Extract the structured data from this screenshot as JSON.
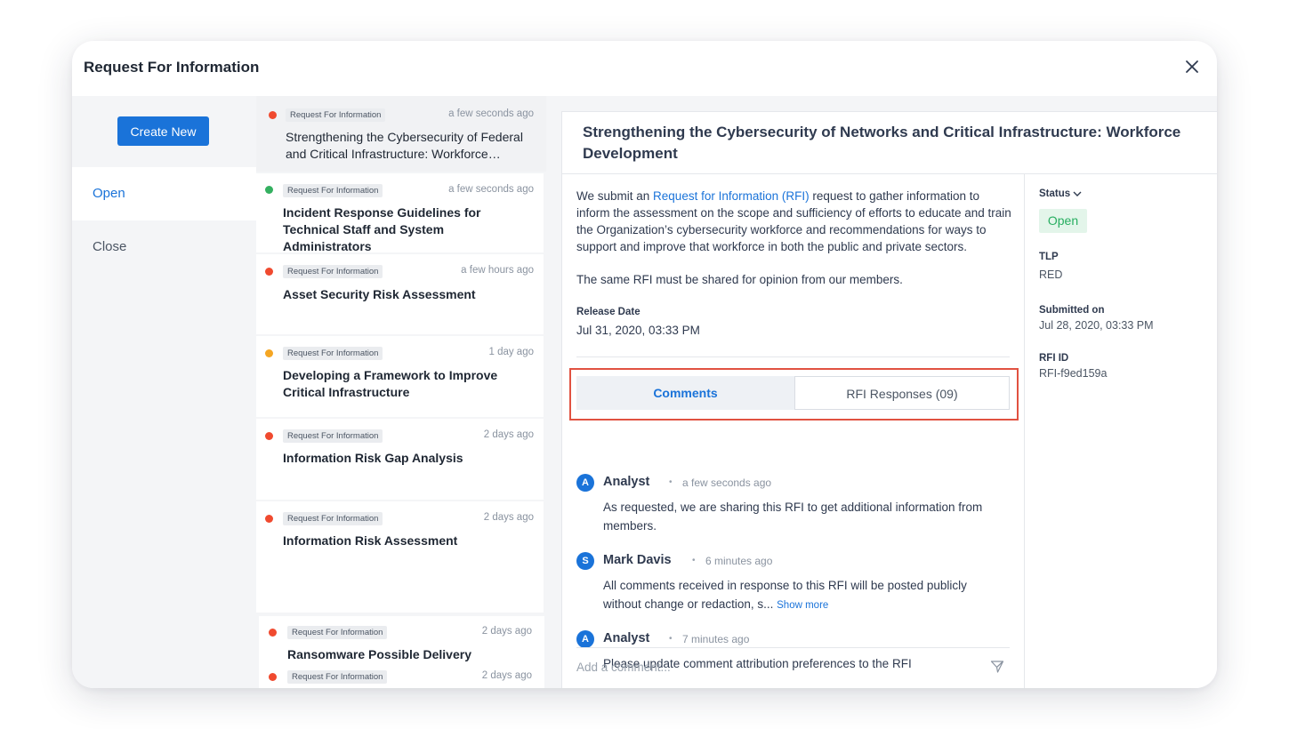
{
  "modal": {
    "title": "Request For Information"
  },
  "sidebar": {
    "create_label": "Create New",
    "nav": [
      {
        "label": "Open"
      },
      {
        "label": "Close"
      }
    ]
  },
  "list": {
    "items": [
      {
        "tag": "Request For Information",
        "time": "a few seconds ago",
        "title": "Strengthening the Cybersecurity of Federal and Critical Infrastructure: Workforce…",
        "status_color": "#f04a2f",
        "selected": true
      },
      {
        "tag": "Request For Information",
        "time": "a few seconds ago",
        "title": "Incident Response Guidelines for Technical Staff and System Administrators",
        "status_color": "#34b060"
      },
      {
        "tag": "Request For Information",
        "time": "a few hours ago",
        "title": "Asset Security Risk Assessment",
        "status_color": "#f04a2f"
      },
      {
        "tag": "Request For Information",
        "time": "1 day ago",
        "title": "Developing a Framework to Improve Critical Infrastructure",
        "status_color": "#f5a623"
      },
      {
        "tag": "Request For Information",
        "time": "2 days ago",
        "title": "Information Risk Gap Analysis",
        "status_color": "#f04a2f"
      },
      {
        "tag": "Request For Information",
        "time": "2 days ago",
        "title": "Information Risk Assessment",
        "status_color": "#f04a2f"
      },
      {
        "tag": "Request For Information",
        "time": "2 days ago",
        "title": "Ransomware Possible Delivery Mechanisms",
        "status_color": "#f04a2f"
      },
      {
        "tag": "Request For Information",
        "time": "2 days ago",
        "title": "",
        "status_color": "#f04a2f"
      }
    ]
  },
  "detail": {
    "title": "Strengthening the Cybersecurity of Networks and Critical Infrastructure: Workforce Development",
    "desc_prefix": "We submit an ",
    "desc_link": "Request for Information (RFI)",
    "desc_suffix": " request to gather information to inform the assessment on the scope and sufficiency of efforts to educate and train the Organization’s cybersecurity workforce and recommendations for ways to support and improve that workforce in both the public and private sectors.",
    "desc2": "The same RFI must be shared for opinion from our members.",
    "release_label": "Release Date",
    "release_value": "Jul 31, 2020, 03:33 PM",
    "tabs": {
      "comments": "Comments",
      "responses": "RFI Responses (09)"
    },
    "comments": [
      {
        "initial": "A",
        "author": "Analyst",
        "time": "a few seconds ago",
        "text": "As requested, we are sharing this RFI to get additional information from members."
      },
      {
        "initial": "S",
        "author": "Mark Davis",
        "time": "6 minutes ago",
        "text": "All comments received in response to this RFI will be posted publicly without change or redaction, s...",
        "show_more": "Show more"
      },
      {
        "initial": "A",
        "author": "Analyst",
        "time": "7 minutes ago",
        "text": "Please update comment attribution preferences to the RFI"
      }
    ],
    "add_placeholder": "Add a comment..."
  },
  "meta": {
    "status_label": "Status",
    "status_value": "Open",
    "tlp_label": "TLP",
    "tlp_value": "RED",
    "submitted_label": "Submitted on",
    "submitted_value": "Jul 28, 2020, 03:33 PM",
    "rfi_id_label": "RFI ID",
    "rfi_id_value": "RFI-f9ed159a"
  },
  "colors": {
    "accent": "#1a73d9",
    "highlight_outline": "#e15241",
    "status_open_bg": "#e3f5ea",
    "status_open_text": "#27ae60"
  }
}
